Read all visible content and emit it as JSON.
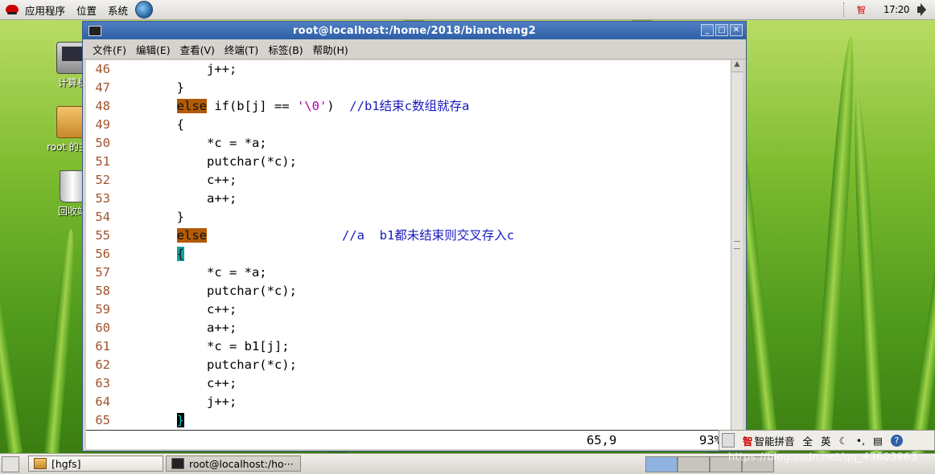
{
  "top_panel": {
    "menus": [
      "应用程序",
      "位置",
      "系统"
    ],
    "ime_indicator": "智",
    "clock": "17:20"
  },
  "desktop_icons": [
    {
      "label": "计算机"
    },
    {
      "label": "root 的主文"
    },
    {
      "label": "回收站"
    }
  ],
  "window": {
    "title": "root@localhost:/home/2018/biancheng2",
    "menu": [
      "文件(F)",
      "编辑(E)",
      "查看(V)",
      "终端(T)",
      "标签(B)",
      "帮助(H)"
    ]
  },
  "editor": {
    "lines": [
      {
        "n": "46",
        "code": "            j++;"
      },
      {
        "n": "47",
        "code": "        }"
      },
      {
        "n": "48",
        "pre": "        ",
        "kw": "else",
        "mid": " if(b[j] == ",
        "str": "'\\0'",
        "post": ")  ",
        "cmt": "//b1结束c数组就存a"
      },
      {
        "n": "49",
        "code": "        {"
      },
      {
        "n": "50",
        "code": "            *c = *a;"
      },
      {
        "n": "51",
        "code": "            putchar(*c);"
      },
      {
        "n": "52",
        "code": "            c++;"
      },
      {
        "n": "53",
        "code": "            a++;"
      },
      {
        "n": "54",
        "code": "        }"
      },
      {
        "n": "55",
        "pre": "        ",
        "kw": "else",
        "mid": "                  ",
        "cmt": "//a  b1都未结束则交叉存入c"
      },
      {
        "n": "56",
        "pre": "        ",
        "paren": "{"
      },
      {
        "n": "57",
        "code": "            *c = *a;"
      },
      {
        "n": "58",
        "code": "            putchar(*c);"
      },
      {
        "n": "59",
        "code": "            c++;"
      },
      {
        "n": "60",
        "code": "            a++;"
      },
      {
        "n": "61",
        "code": "            *c = b1[j];"
      },
      {
        "n": "62",
        "code": "            putchar(*c);"
      },
      {
        "n": "63",
        "code": "            c++;"
      },
      {
        "n": "64",
        "code": "            j++;"
      },
      {
        "n": "65",
        "pre": "        ",
        "cursor": "}"
      }
    ],
    "status_pos": "65,9",
    "status_pct": "93%"
  },
  "ime_bar": {
    "logo": "智",
    "name": "智能拼音",
    "full": "全",
    "lang": "英"
  },
  "taskbar": {
    "items": [
      {
        "label": "[hgfs]"
      },
      {
        "label": "root@localhost:/ho···"
      }
    ]
  },
  "watermark": "https://blog.csdn.net/qq_43603963"
}
